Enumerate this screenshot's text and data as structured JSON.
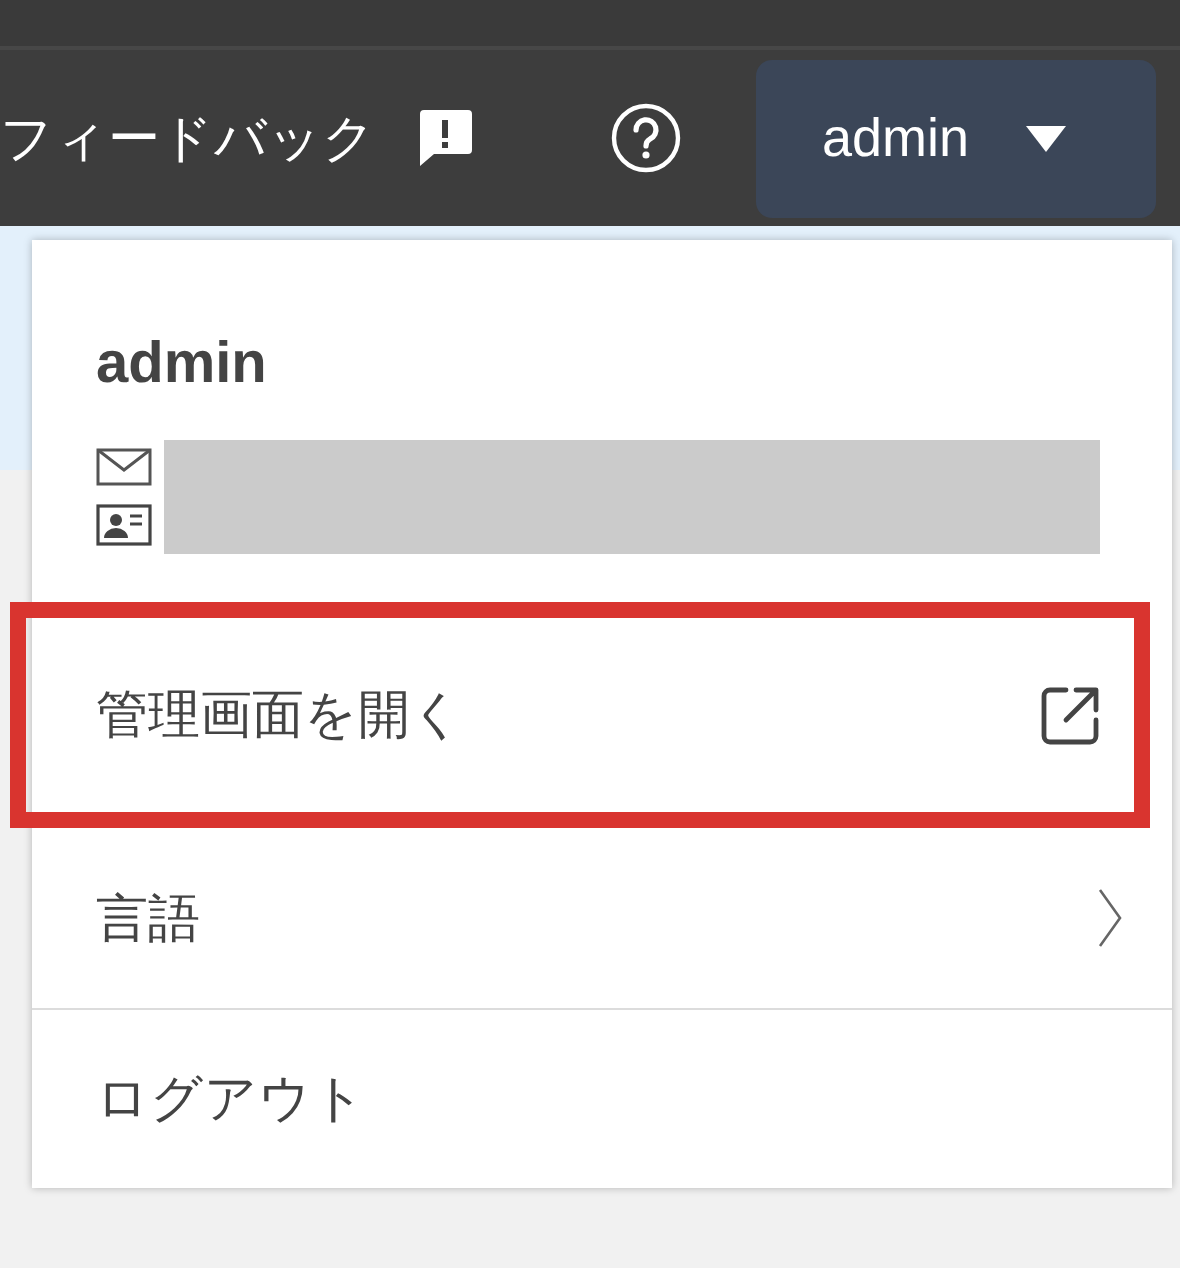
{
  "header": {
    "feedback": "フィードバック",
    "account_button": "admin"
  },
  "user_menu": {
    "name": "admin",
    "items": [
      {
        "label": "管理画面を開く",
        "kind": "external",
        "highlighted": true
      },
      {
        "label": "言語",
        "kind": "submenu",
        "highlighted": false
      },
      {
        "label": "ログアウト",
        "kind": "plain",
        "highlighted": false
      }
    ]
  }
}
